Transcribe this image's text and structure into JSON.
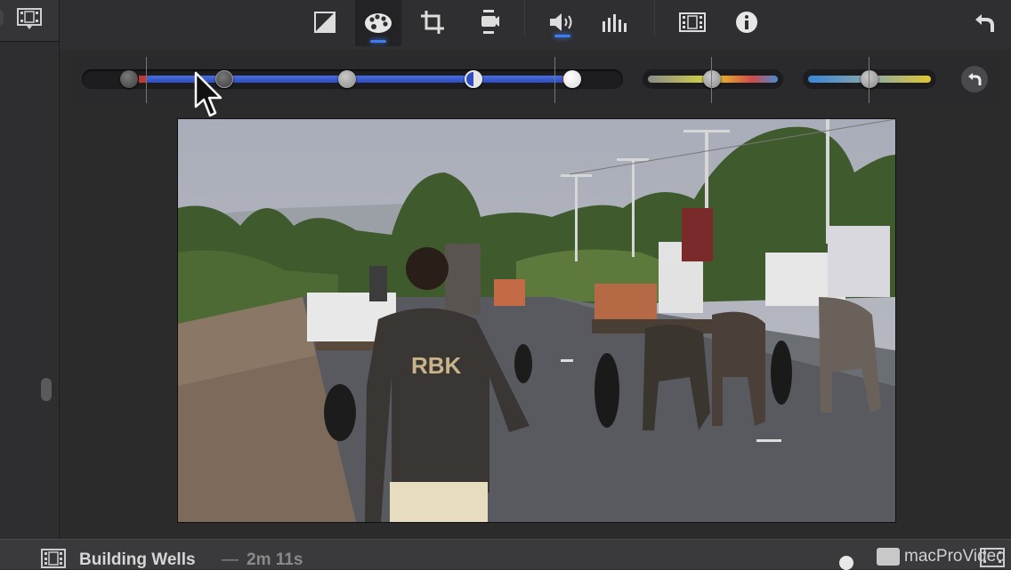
{
  "toolbar": {
    "tools": [
      {
        "name": "color-balance",
        "active": false
      },
      {
        "name": "color-correction",
        "active": true
      },
      {
        "name": "cropping",
        "active": false
      },
      {
        "name": "stabilization",
        "active": false
      },
      {
        "name": "volume",
        "active": true
      },
      {
        "name": "noise-reduction-equalizer",
        "active": false
      },
      {
        "name": "speed",
        "active": false
      },
      {
        "name": "clip-info",
        "active": false
      }
    ]
  },
  "colors": {
    "accent": "#3d7cf4",
    "background": "#2b2b2c",
    "toolbar": "#2f2f31"
  },
  "project": {
    "title": "Building Wells",
    "separator": "—",
    "duration": "2m 11s"
  },
  "watermark": {
    "text": "macProVideo"
  }
}
